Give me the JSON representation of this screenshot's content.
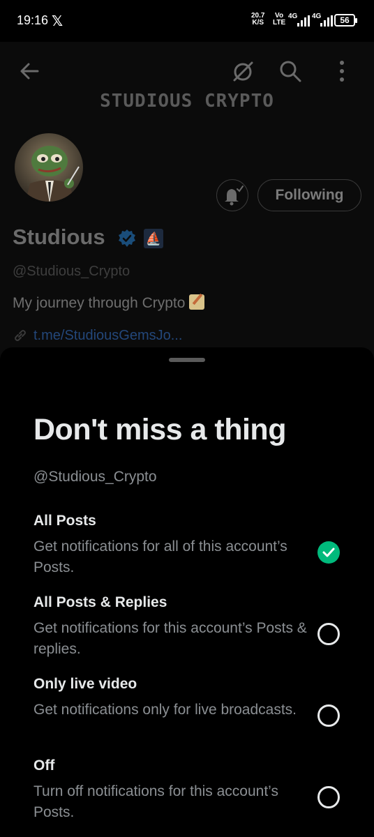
{
  "status_bar": {
    "time": "19:16",
    "network_speed_value": "20.7",
    "network_speed_unit": "K/S",
    "volte_top": "Vo",
    "volte_bottom": "LTE",
    "signal_1": "4G",
    "signal_2": "4G",
    "battery": "56"
  },
  "profile": {
    "banner_title": "STUDIOUS CRYPTO",
    "display_name": "Studious",
    "affiliate_badge": "⛵",
    "handle": "@Studious_Crypto",
    "bio": "My journey through Crypto",
    "link": "t.me/StudiousGemsJo...",
    "following_label": "Following"
  },
  "sheet": {
    "title": "Don't miss a thing",
    "handle": "@Studious_Crypto",
    "options": [
      {
        "title": "All Posts",
        "description": "Get notifications for all of this account’s Posts.",
        "selected": true
      },
      {
        "title": "All Posts & Replies",
        "description": "Get notifications for this account’s Posts & replies.",
        "selected": false
      },
      {
        "title": "Only live video",
        "description": "Get notifications only for live broadcasts.",
        "selected": false
      },
      {
        "title": "Off",
        "description": "Turn off notifications for this account’s Posts.",
        "selected": false
      }
    ]
  },
  "colors": {
    "accent_green": "#00ba7c",
    "verified_blue": "#1d9bf0"
  },
  "icons": [
    "back-arrow-icon",
    "hide-icon",
    "search-icon",
    "more-vertical-icon",
    "bell-check-icon",
    "verified-icon",
    "link-icon",
    "check-icon"
  ]
}
